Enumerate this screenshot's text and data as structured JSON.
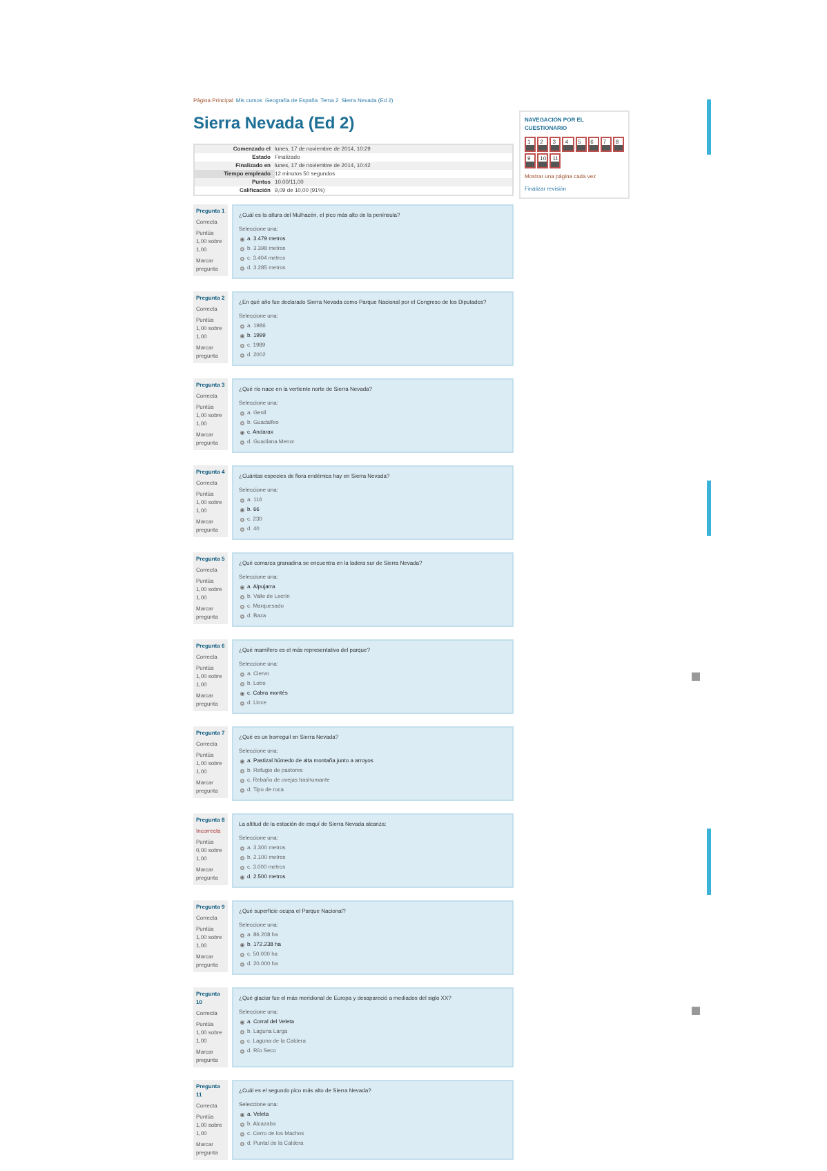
{
  "breadcrumb": [
    "Página Principal",
    "Mis cursos",
    "Geografía de España",
    "Tema 2",
    "Sierra Nevada (Ed 2)"
  ],
  "title": "Sierra Nevada (Ed 2)",
  "summary": [
    {
      "label": "Comenzado el",
      "value": "lunes, 17 de noviembre de 2014, 10:29"
    },
    {
      "label": "Estado",
      "value": "Finalizado"
    },
    {
      "label": "Finalizado en",
      "value": "lunes, 17 de noviembre de 2014, 10:42"
    },
    {
      "label": "Tiempo empleado",
      "value": "12 minutos 50 segundos"
    },
    {
      "label": "Puntos",
      "value": "10,00/11,00"
    },
    {
      "label": "Calificación",
      "value": "9,09 de 10,00 (91%)"
    }
  ],
  "questions": [
    {
      "number": "Pregunta 1",
      "state": "Correcta",
      "score": "Puntúa 1,00 sobre 1,00",
      "flag": "Marcar pregunta",
      "text": "¿Cuál es la altura del Mulhacén, el pico más alto de la península?",
      "prompt": "Seleccione una:",
      "options": [
        {
          "text": "a. 3.479 metros",
          "selected": true
        },
        {
          "text": "b. 3.398 metros",
          "selected": false
        },
        {
          "text": "c. 3.404 metros",
          "selected": false
        },
        {
          "text": "d. 3.285 metros",
          "selected": false
        }
      ]
    },
    {
      "number": "Pregunta 2",
      "state": "Correcta",
      "score": "Puntúa 1,00 sobre 1,00",
      "flag": "Marcar pregunta",
      "text": "¿En qué año fue declarado Sierra Nevada como Parque Nacional por el Congreso de los Diputados?",
      "prompt": "Seleccione una:",
      "options": [
        {
          "text": "a. 1986",
          "selected": false
        },
        {
          "text": "b. 1999",
          "selected": true
        },
        {
          "text": "c. 1989",
          "selected": false
        },
        {
          "text": "d. 2002",
          "selected": false
        }
      ]
    },
    {
      "number": "Pregunta 3",
      "state": "Correcta",
      "score": "Puntúa 1,00 sobre 1,00",
      "flag": "Marcar pregunta",
      "text": "¿Qué río nace en la vertiente norte de Sierra Nevada?",
      "prompt": "Seleccione una:",
      "options": [
        {
          "text": "a. Genil",
          "selected": false
        },
        {
          "text": "b. Guadalfeo",
          "selected": false
        },
        {
          "text": "c. Andarax",
          "selected": true
        },
        {
          "text": "d. Guadiana Menor",
          "selected": false
        }
      ]
    },
    {
      "number": "Pregunta 4",
      "state": "Correcta",
      "score": "Puntúa 1,00 sobre 1,00",
      "flag": "Marcar pregunta",
      "text": "¿Cuántas especies de flora endémica hay en Sierra Nevada?",
      "prompt": "Seleccione una:",
      "options": [
        {
          "text": "a. 116",
          "selected": false
        },
        {
          "text": "b. 66",
          "selected": true
        },
        {
          "text": "c. 230",
          "selected": false
        },
        {
          "text": "d. 40",
          "selected": false
        }
      ]
    },
    {
      "number": "Pregunta 5",
      "state": "Correcta",
      "score": "Puntúa 1,00 sobre 1,00",
      "flag": "Marcar pregunta",
      "text": "¿Qué comarca granadina se encuentra en la ladera sur de Sierra Nevada?",
      "prompt": "Seleccione una:",
      "options": [
        {
          "text": "a. Alpujarra",
          "selected": true
        },
        {
          "text": "b. Valle de Lecrín",
          "selected": false
        },
        {
          "text": "c. Marquesado",
          "selected": false
        },
        {
          "text": "d. Baza",
          "selected": false
        }
      ]
    },
    {
      "number": "Pregunta 6",
      "state": "Correcta",
      "score": "Puntúa 1,00 sobre 1,00",
      "flag": "Marcar pregunta",
      "text": "¿Qué mamífero es el más representativo del parque?",
      "prompt": "Seleccione una:",
      "options": [
        {
          "text": "a. Ciervo",
          "selected": false
        },
        {
          "text": "b. Lobo",
          "selected": false
        },
        {
          "text": "c. Cabra montés",
          "selected": true
        },
        {
          "text": "d. Lince",
          "selected": false
        }
      ]
    },
    {
      "number": "Pregunta 7",
      "state": "Correcta",
      "score": "Puntúa 1,00 sobre 1,00",
      "flag": "Marcar pregunta",
      "text": "¿Qué es un borreguil en Sierra Nevada?",
      "prompt": "Seleccione una:",
      "options": [
        {
          "text": "a. Pastizal húmedo de alta montaña junto a arroyos",
          "selected": true
        },
        {
          "text": "b. Refugio de pastores",
          "selected": false
        },
        {
          "text": "c. Rebaño de ovejas trashumante",
          "selected": false
        },
        {
          "text": "d. Tipo de roca",
          "selected": false
        }
      ]
    },
    {
      "number": "Pregunta 8",
      "state": "Incorrecta",
      "score": "Puntúa 0,00 sobre 1,00",
      "flag": "Marcar pregunta",
      "text": "La altitud de la estación de esquí de Sierra Nevada alcanza:",
      "prompt": "Seleccione una:",
      "options": [
        {
          "text": "a. 3.300 metros",
          "selected": false
        },
        {
          "text": "b. 2.100 metros",
          "selected": false
        },
        {
          "text": "c. 3.000 metros",
          "selected": false
        },
        {
          "text": "d. 2.500 metros",
          "selected": true
        }
      ]
    },
    {
      "number": "Pregunta 9",
      "state": "Correcta",
      "score": "Puntúa 1,00 sobre 1,00",
      "flag": "Marcar pregunta",
      "text": "¿Qué superficie ocupa el Parque Nacional?",
      "prompt": "Seleccione una:",
      "options": [
        {
          "text": "a. 86.208 ha",
          "selected": false
        },
        {
          "text": "b. 172.238 ha",
          "selected": true
        },
        {
          "text": "c. 50.000 ha",
          "selected": false
        },
        {
          "text": "d. 20.000 ha",
          "selected": false
        }
      ]
    },
    {
      "number": "Pregunta 10",
      "state": "Correcta",
      "score": "Puntúa 1,00 sobre 1,00",
      "flag": "Marcar pregunta",
      "text": "¿Qué glaciar fue el más meridional de Europa y desapareció a mediados del siglo XX?",
      "prompt": "Seleccione una:",
      "options": [
        {
          "text": "a. Corral del Veleta",
          "selected": true
        },
        {
          "text": "b. Laguna Larga",
          "selected": false
        },
        {
          "text": "c. Laguna de la Caldera",
          "selected": false
        },
        {
          "text": "d. Río Seco",
          "selected": false
        }
      ]
    },
    {
      "number": "Pregunta 11",
      "state": "Correcta",
      "score": "Puntúa 1,00 sobre 1,00",
      "flag": "Marcar pregunta",
      "text": "¿Cuál es el segundo pico más alto de Sierra Nevada?",
      "prompt": "Seleccione una:",
      "options": [
        {
          "text": "a. Veleta",
          "selected": true
        },
        {
          "text": "b. Alcazaba",
          "selected": false
        },
        {
          "text": "c. Cerro de los Machos",
          "selected": false
        },
        {
          "text": "d. Puntal de la Caldera",
          "selected": false
        }
      ]
    }
  ],
  "navigation": {
    "title": "NAVEGACIÓN POR EL CUESTIONARIO",
    "buttons": [
      {
        "label": "1"
      },
      {
        "label": "2"
      },
      {
        "label": "3"
      },
      {
        "label": "4"
      },
      {
        "label": "5"
      },
      {
        "label": "6"
      },
      {
        "label": "7"
      },
      {
        "label": "8"
      },
      {
        "label": "9"
      },
      {
        "label": "10"
      },
      {
        "label": "11"
      }
    ],
    "links": [
      "Mostrar una página cada vez",
      "Finalizar revisión"
    ]
  }
}
